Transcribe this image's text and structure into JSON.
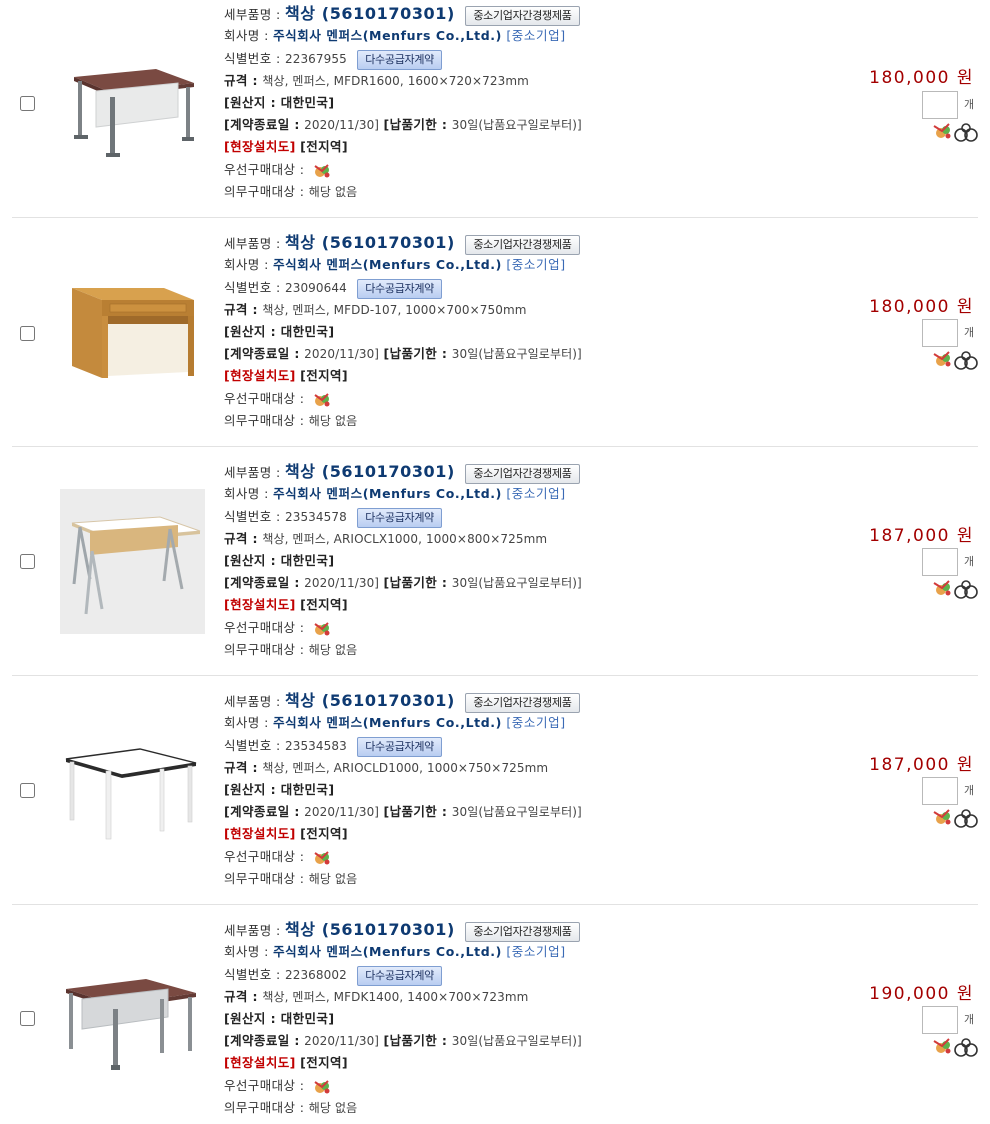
{
  "labels": {
    "detail_name": "세부품명 :",
    "company": "회사명 :",
    "id": "식별번호 :",
    "spec": "규격 :",
    "origin": "[원산지 : 대한민국]",
    "contract_end": "[계약종료일 :",
    "delivery": "[납품기한 :",
    "install_drawing": "[현장설치도]",
    "region": "[전지역]",
    "priority": "우선구매대상 :",
    "mandatory": "의무구매대상 :",
    "mandatory_value": "해당 없음",
    "unit": "개"
  },
  "products": [
    {
      "name": "책상 (5610170301)",
      "badge_competition": "중소기업자간경쟁제품",
      "company": "주식회사 멘퍼스(Menfurs Co.,Ltd.)",
      "company_type": "[중소기업]",
      "id_number": "22367955",
      "badge_contract": "다수공급자계약",
      "spec": "책상, 멘퍼스, MFDR1600, 1600×720×723mm",
      "contract_end_date": "2020/11/30]",
      "delivery_term": "30일(납품요구일로부터)]",
      "price": "180,000 원",
      "qty": "",
      "image": "desk-mahogany-grey-panel"
    },
    {
      "name": "책상 (5610170301)",
      "badge_competition": "중소기업자간경쟁제품",
      "company": "주식회사 멘퍼스(Menfurs Co.,Ltd.)",
      "company_type": "[중소기업]",
      "id_number": "23090644",
      "badge_contract": "다수공급자계약",
      "spec": "책상, 멘퍼스, MFDD-107, 1000×700×750mm",
      "contract_end_date": "2020/11/30]",
      "delivery_term": "30일(납품요구일로부터)]",
      "price": "180,000 원",
      "qty": "",
      "image": "desk-oak-drawer"
    },
    {
      "name": "책상 (5610170301)",
      "badge_competition": "중소기업자간경쟁제품",
      "company": "주식회사 멘퍼스(Menfurs Co.,Ltd.)",
      "company_type": "[중소기업]",
      "id_number": "23534578",
      "badge_contract": "다수공급자계약",
      "spec": "책상, 멘퍼스, ARIOCLX1000, 1000×800×725mm",
      "contract_end_date": "2020/11/30]",
      "delivery_term": "30일(납품요구일로부터)]",
      "price": "187,000 원",
      "qty": "",
      "image": "desk-white-a-frame"
    },
    {
      "name": "책상 (5610170301)",
      "badge_competition": "중소기업자간경쟁제품",
      "company": "주식회사 멘퍼스(Menfurs Co.,Ltd.)",
      "company_type": "[중소기업]",
      "id_number": "23534583",
      "badge_contract": "다수공급자계약",
      "spec": "책상, 멘퍼스, ARIOCLD1000, 1000×750×725mm",
      "contract_end_date": "2020/11/30]",
      "delivery_term": "30일(납품요구일로부터)]",
      "price": "187,000 원",
      "qty": "",
      "image": "desk-white-four-legs"
    },
    {
      "name": "책상 (5610170301)",
      "badge_competition": "중소기업자간경쟁제품",
      "company": "주식회사 멘퍼스(Menfurs Co.,Ltd.)",
      "company_type": "[중소기업]",
      "id_number": "22368002",
      "badge_contract": "다수공급자계약",
      "spec": "책상, 멘퍼스, MFDK1400, 1400×700×723mm",
      "contract_end_date": "2020/11/30]",
      "delivery_term": "30일(납품요구일로부터)]",
      "price": "190,000 원",
      "qty": "",
      "image": "desk-mahogany-grey-frame"
    }
  ]
}
